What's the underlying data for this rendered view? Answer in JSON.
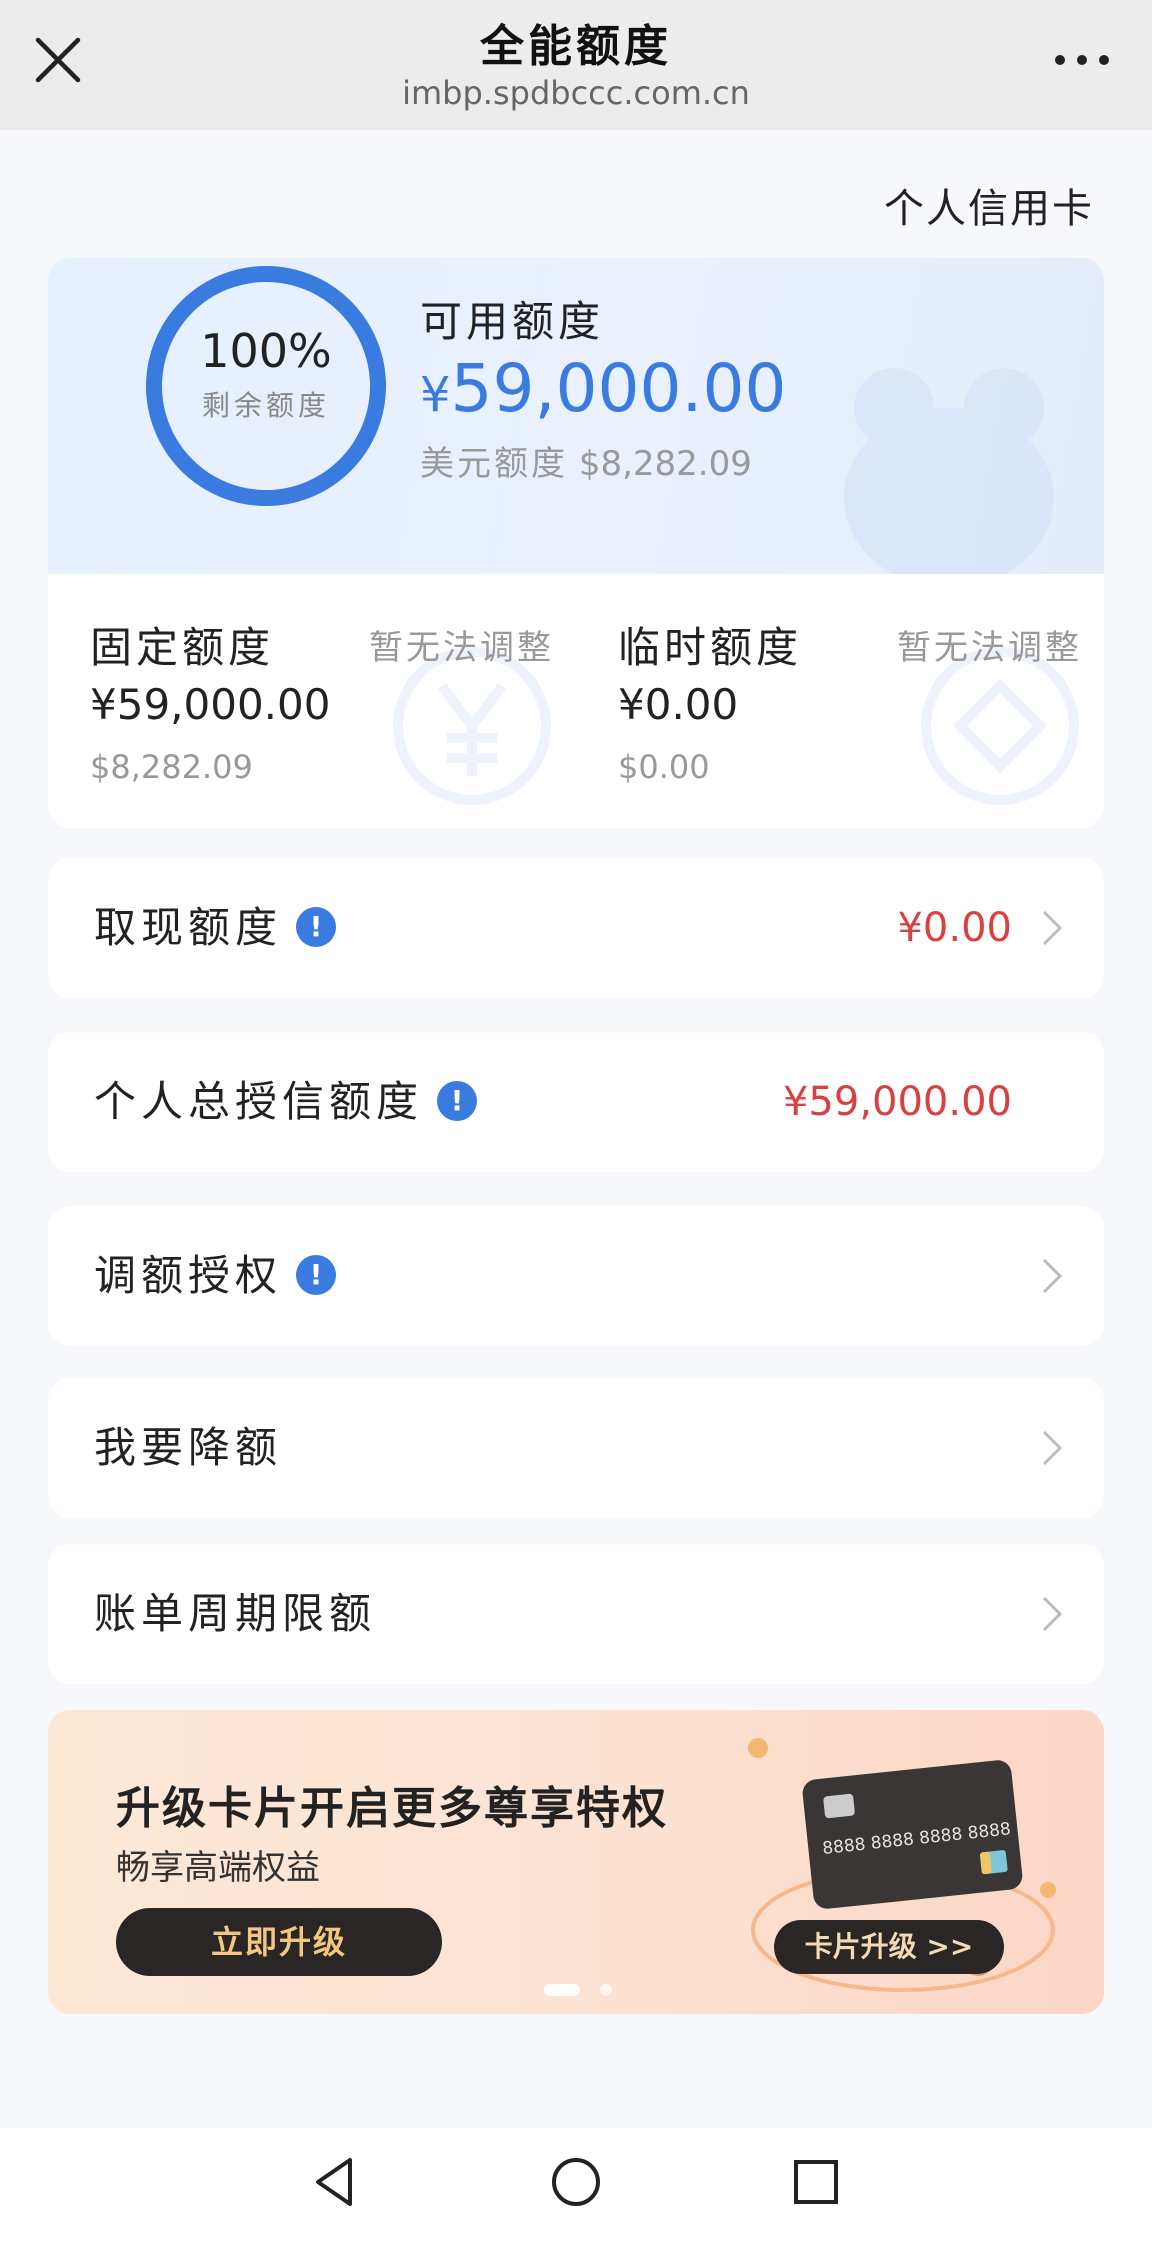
{
  "header": {
    "title": "全能额度",
    "url": "imbp.spdbccc.com.cn"
  },
  "card_type": "个人信用卡",
  "available": {
    "ring_percent": "100%",
    "ring_fill": 1.0,
    "ring_label": "剩余额度",
    "label": "可用额度",
    "currency": "¥",
    "amount": "59,000.00",
    "usd_label": "美元额度",
    "usd_amount": "$8,282.09"
  },
  "fixed": {
    "title": "固定额度",
    "note": "暂无法调整",
    "amount": "¥59,000.00",
    "usd": "$8,282.09"
  },
  "temporary": {
    "title": "临时额度",
    "note": "暂无法调整",
    "amount": "¥0.00",
    "usd": "$0.00"
  },
  "rows": [
    {
      "label": "取现额度",
      "value": "¥0.00"
    },
    {
      "label": "个人总授信额度",
      "value": "¥59,000.00"
    },
    {
      "label": "调额授权",
      "value": ""
    },
    {
      "label": "我要降额",
      "value": ""
    },
    {
      "label": "账单周期限额",
      "value": ""
    }
  ],
  "info_glyph": "!",
  "banner": {
    "title": "升级卡片开启更多尊享特权",
    "subtitle": "畅享高端权益",
    "button": "立即升级",
    "card_number": "8888 8888 8888 8888",
    "badge": "卡片升级 >>"
  },
  "colors": {
    "accent": "#3a7be0",
    "amount_red": "#d94141",
    "banner_dark": "#2b2626"
  },
  "icons": [
    "close-icon",
    "more-icon",
    "info-icon",
    "chevron-right-icon",
    "back-icon",
    "home-icon",
    "recents-icon"
  ]
}
